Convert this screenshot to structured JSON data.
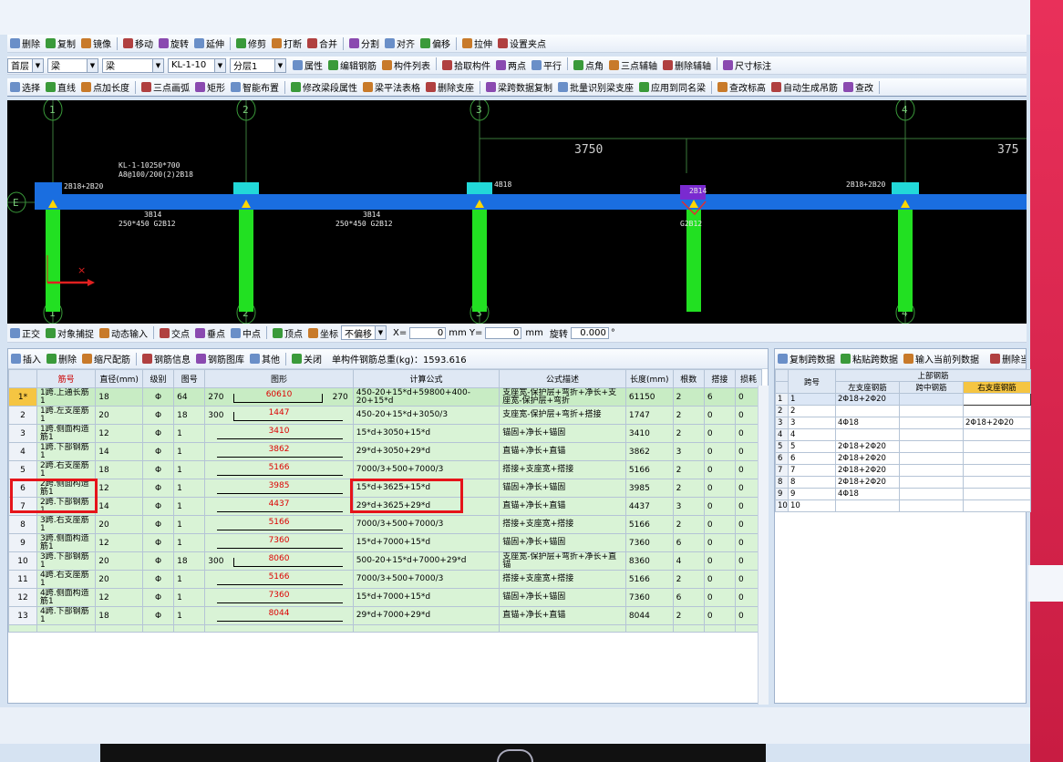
{
  "toolbar1": [
    "删除",
    "复制",
    "镜像",
    "移动",
    "旋转",
    "延伸",
    "修剪",
    "打断",
    "合并",
    "分割",
    "对齐",
    "偏移",
    "拉伸",
    "设置夹点"
  ],
  "toolbar2": {
    "floor": "首层",
    "type1": "梁",
    "type2": "梁",
    "comp": "KL-1-10",
    "layer": "分层1",
    "btns": [
      "属性",
      "编辑钢筋",
      "构件列表",
      "拾取构件",
      "两点",
      "平行",
      "点角",
      "三点辅轴",
      "删除辅轴",
      "尺寸标注"
    ]
  },
  "toolbar3": [
    "选择",
    "直线",
    "点加长度",
    "三点画弧",
    "矩形",
    "智能布置",
    "修改梁段属性",
    "梁平法表格",
    "删除支座",
    "梁跨数据复制",
    "批量识别梁支座",
    "应用到同名梁",
    "查改标高",
    "自动生成吊筋",
    "查改"
  ],
  "cad": {
    "axes": [
      "1",
      "2",
      "3",
      "4"
    ],
    "rowaxis": "E",
    "dims": [
      "3750",
      "375"
    ],
    "labels": [
      "KL-1-10250*700",
      "A8@100/200(2)2B18",
      "2B18+2B20",
      "3B14",
      "250*450 G2B12",
      "3B14",
      "250*450 G2B12",
      "4B18",
      "2B14",
      "G2B12",
      "2B18+2B20"
    ]
  },
  "snapbar": {
    "items": [
      "正交",
      "对象捕捉",
      "动态输入",
      "交点",
      "垂点",
      "中点",
      "顶点",
      "坐标"
    ],
    "offset": "不偏移",
    "x_label": "X=",
    "x": "0",
    "y_label": "mm Y=",
    "y": "0",
    "unit": "mm",
    "rotate_label": "旋转",
    "rotate": "0.000",
    "deg": "°"
  },
  "rebarbar": {
    "btns": [
      "插入",
      "删除",
      "缩尺配筋",
      "钢筋信息",
      "钢筋图库",
      "其他",
      "关闭"
    ],
    "total": "单构件钢筋总重(kg)：1593.616"
  },
  "rebar": {
    "headers": [
      "筋号",
      "直径(mm)",
      "级别",
      "图号",
      "图形",
      "计算公式",
      "公式描述",
      "长度(mm)",
      "根数",
      "搭接",
      "损耗"
    ],
    "rows": [
      {
        "n": "1*",
        "name": "1跨.上通长筋1",
        "d": "18",
        "g": "Φ",
        "fig": "64",
        "l": "270",
        "mid": "60610",
        "r": "270",
        "f": "450-20+15*d+59800+400-20+15*d",
        "desc": "支座宽-保护层+弯折+净长+支座宽-保护层+弯折",
        "len": "61150",
        "cnt": "2",
        "lap": "6",
        "loss": "0"
      },
      {
        "n": "2",
        "name": "1跨.左支座筋1",
        "d": "20",
        "g": "Φ",
        "fig": "18",
        "l": "300",
        "mid": "1447",
        "r": "",
        "f": "450-20+15*d+3050/3",
        "desc": "支座宽-保护层+弯折+搭接",
        "len": "1747",
        "cnt": "2",
        "lap": "0",
        "loss": "0"
      },
      {
        "n": "3",
        "name": "1跨.侧面构造筋1",
        "d": "12",
        "g": "Φ",
        "fig": "1",
        "l": "",
        "mid": "3410",
        "r": "",
        "f": "15*d+3050+15*d",
        "desc": "锚固+净长+锚固",
        "len": "3410",
        "cnt": "2",
        "lap": "0",
        "loss": "0"
      },
      {
        "n": "4",
        "name": "1跨.下部钢筋1",
        "d": "14",
        "g": "Φ",
        "fig": "1",
        "l": "",
        "mid": "3862",
        "r": "",
        "f": "29*d+3050+29*d",
        "desc": "直锚+净长+直锚",
        "len": "3862",
        "cnt": "3",
        "lap": "0",
        "loss": "0"
      },
      {
        "n": "5",
        "name": "2跨.右支座筋1",
        "d": "18",
        "g": "Φ",
        "fig": "1",
        "l": "",
        "mid": "5166",
        "r": "",
        "f": "7000/3+500+7000/3",
        "desc": "搭接+支座宽+搭接",
        "len": "5166",
        "cnt": "2",
        "lap": "0",
        "loss": "0"
      },
      {
        "n": "6",
        "name": "2跨.侧面构造筋1",
        "d": "12",
        "g": "Φ",
        "fig": "1",
        "l": "",
        "mid": "3985",
        "r": "",
        "f": "15*d+3625+15*d",
        "desc": "锚固+净长+锚固",
        "len": "3985",
        "cnt": "2",
        "lap": "0",
        "loss": "0"
      },
      {
        "n": "7",
        "name": "2跨.下部钢筋1",
        "d": "14",
        "g": "Φ",
        "fig": "1",
        "l": "",
        "mid": "4437",
        "r": "",
        "f": "29*d+3625+29*d",
        "desc": "直锚+净长+直锚",
        "len": "4437",
        "cnt": "3",
        "lap": "0",
        "loss": "0"
      },
      {
        "n": "8",
        "name": "3跨.右支座筋1",
        "d": "20",
        "g": "Φ",
        "fig": "1",
        "l": "",
        "mid": "5166",
        "r": "",
        "f": "7000/3+500+7000/3",
        "desc": "搭接+支座宽+搭接",
        "len": "5166",
        "cnt": "2",
        "lap": "0",
        "loss": "0"
      },
      {
        "n": "9",
        "name": "3跨.侧面构造筋1",
        "d": "12",
        "g": "Φ",
        "fig": "1",
        "l": "",
        "mid": "7360",
        "r": "",
        "f": "15*d+7000+15*d",
        "desc": "锚固+净长+锚固",
        "len": "7360",
        "cnt": "6",
        "lap": "0",
        "loss": "0"
      },
      {
        "n": "10",
        "name": "3跨.下部钢筋1",
        "d": "20",
        "g": "Φ",
        "fig": "18",
        "l": "300",
        "mid": "8060",
        "r": "",
        "f": "500-20+15*d+7000+29*d",
        "desc": "支座宽-保护层+弯折+净长+直锚",
        "len": "8360",
        "cnt": "4",
        "lap": "0",
        "loss": "0"
      },
      {
        "n": "11",
        "name": "4跨.右支座筋1",
        "d": "20",
        "g": "Φ",
        "fig": "1",
        "l": "",
        "mid": "5166",
        "r": "",
        "f": "7000/3+500+7000/3",
        "desc": "搭接+支座宽+搭接",
        "len": "5166",
        "cnt": "2",
        "lap": "0",
        "loss": "0"
      },
      {
        "n": "12",
        "name": "4跨.侧面构造筋1",
        "d": "12",
        "g": "Φ",
        "fig": "1",
        "l": "",
        "mid": "7360",
        "r": "",
        "f": "15*d+7000+15*d",
        "desc": "锚固+净长+锚固",
        "len": "7360",
        "cnt": "6",
        "lap": "0",
        "loss": "0"
      },
      {
        "n": "13",
        "name": "4跨.下部钢筋1",
        "d": "18",
        "g": "Φ",
        "fig": "1",
        "l": "",
        "mid": "8044",
        "r": "",
        "f": "29*d+7000+29*d",
        "desc": "直锚+净长+直锚",
        "len": "8044",
        "cnt": "2",
        "lap": "0",
        "loss": "0"
      }
    ]
  },
  "spanbar": [
    "复制跨数据",
    "粘贴跨数据",
    "输入当前列数据",
    "删除当前"
  ],
  "span": {
    "h_span": "跨号",
    "h_top": "上部钢筋",
    "cols": [
      "左支座钢筋",
      "跨中钢筋",
      "右支座钢筋"
    ],
    "rows": [
      [
        "1",
        "1",
        "2Φ18+2Φ20",
        "",
        ""
      ],
      [
        "2",
        "2",
        "",
        "",
        ""
      ],
      [
        "3",
        "3",
        "4Φ18",
        "",
        "2Φ18+2Φ20"
      ],
      [
        "4",
        "4",
        "",
        "",
        ""
      ],
      [
        "5",
        "5",
        "2Φ18+2Φ20",
        "",
        ""
      ],
      [
        "6",
        "6",
        "2Φ18+2Φ20",
        "",
        ""
      ],
      [
        "7",
        "7",
        "2Φ18+2Φ20",
        "",
        ""
      ],
      [
        "8",
        "8",
        "2Φ18+2Φ20",
        "",
        ""
      ],
      [
        "9",
        "9",
        "4Φ18",
        "",
        ""
      ],
      [
        "10",
        "10",
        "",
        "",
        ""
      ]
    ]
  }
}
